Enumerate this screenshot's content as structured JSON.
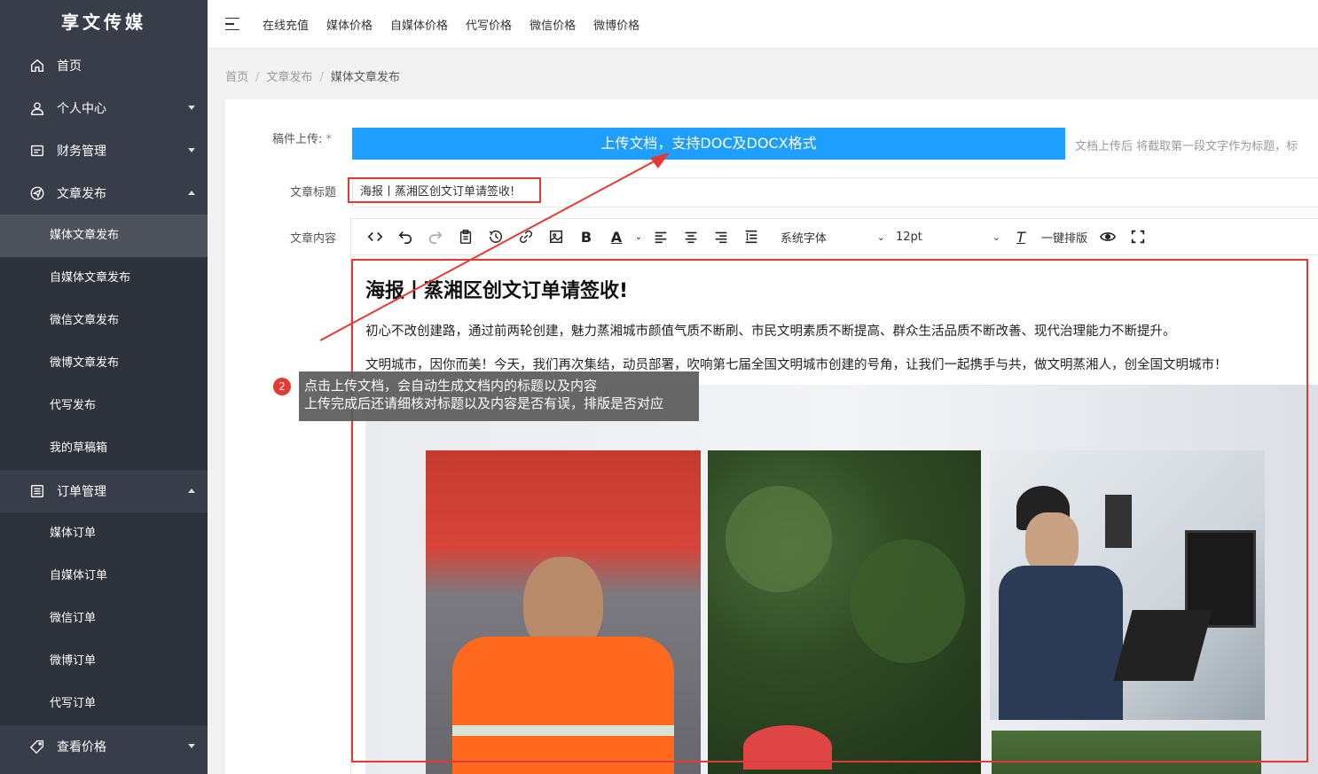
{
  "brand": "享文传媒",
  "sidebar": {
    "items": [
      {
        "label": "首页",
        "icon": "home-icon",
        "caret": ""
      },
      {
        "label": "个人中心",
        "icon": "user-icon",
        "caret": "down"
      },
      {
        "label": "财务管理",
        "icon": "wallet-icon",
        "caret": "down"
      },
      {
        "label": "文章发布",
        "icon": "send-icon",
        "caret": "up"
      }
    ],
    "article_sub": [
      "媒体文章发布",
      "自媒体文章发布",
      "微信文章发布",
      "微博文章发布",
      "代写发布",
      "我的草稿箱"
    ],
    "orders": {
      "label": "订单管理",
      "icon": "list-icon",
      "caret": "up"
    },
    "order_sub": [
      "媒体订单",
      "自媒体订单",
      "微信订单",
      "微博订单",
      "代写订单"
    ],
    "price": {
      "label": "查看价格",
      "icon": "tag-icon",
      "caret": "down"
    }
  },
  "topnav": [
    "在线充值",
    "媒体价格",
    "自媒体价格",
    "代写价格",
    "微信价格",
    "微博价格"
  ],
  "breadcrumb": {
    "home": "首页",
    "section": "文章发布",
    "current": "媒体文章发布"
  },
  "form": {
    "upload_label": "稿件上传:",
    "required_mark": "*",
    "upload_button": "上传文档，支持DOC及DOCX格式",
    "upload_tip": "文档上传后 将截取第一段文字作为标题，标",
    "title_label": "文章标题",
    "title_value": "海报丨蒸湘区创文订单请签收!",
    "content_label": "文章内容"
  },
  "toolbar": {
    "font_family": "系统字体",
    "font_size": "12pt",
    "one_click_format": "一键排版"
  },
  "document": {
    "title": "海报丨蒸湘区创文订单请签收!",
    "para1": "初心不改创建路，通过前两轮创建，魅力蒸湘城市颜值气质不断刷、市民文明素质不断提高、群众生活品质不断改善、现代治理能力不断提升。",
    "para2": "文明城市，因你而美！今天，我们再次集结，动员部署，吹响第七届全国文明城市创建的号角，让我们一起携手与共，做文明蒸湘人，创全国文明城市！"
  },
  "annotation": {
    "badge": "2",
    "line1": "点击上传文档，会自动生成文档内的标题以及内容",
    "line2": "上传完成后还请细核对标题以及内容是否有误，排版是否对应"
  },
  "colors": {
    "sidebar": "#393d49",
    "submenu": "#2e323b",
    "active": "#4e525b",
    "primary": "#1e9fff",
    "annotation": "#e53935"
  }
}
